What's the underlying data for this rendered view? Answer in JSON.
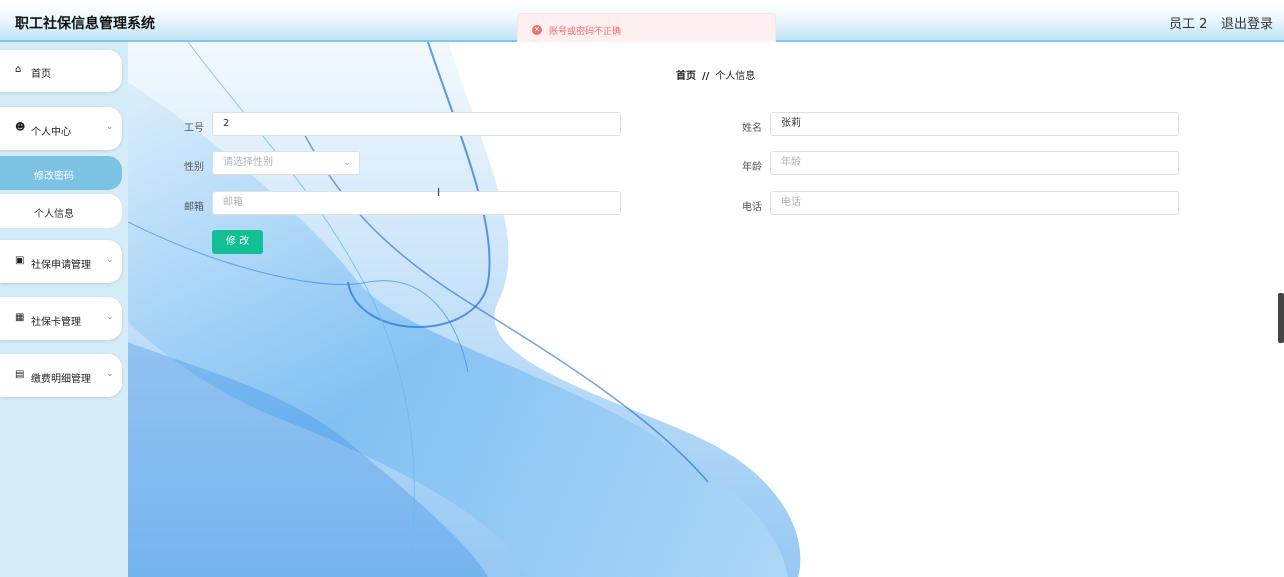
{
  "app": {
    "title": "职工社保信息管理系统"
  },
  "header": {
    "user": "员工 2",
    "logout": "退出登录"
  },
  "toast": {
    "message": "账号或密码不正确",
    "color": "#f56c6c"
  },
  "sidebar": {
    "items": [
      {
        "icon": "home-icon",
        "label": "首页"
      },
      {
        "icon": "user-icon",
        "label": "个人中心",
        "expanded": true,
        "children": [
          {
            "label": "修改密码",
            "active": true
          },
          {
            "label": "个人信息",
            "active": false
          }
        ]
      },
      {
        "icon": "monitor-icon",
        "label": "社保申请管理"
      },
      {
        "icon": "grid-icon",
        "label": "社保卡管理"
      },
      {
        "icon": "receipt-icon",
        "label": "缴费明细管理"
      }
    ]
  },
  "breadcrumb": {
    "home": "首页",
    "separator": "//",
    "current": "个人信息"
  },
  "form": {
    "employee_id": {
      "label": "工号",
      "value": "2"
    },
    "name": {
      "label": "姓名",
      "value": "张莉"
    },
    "gender": {
      "label": "性别",
      "placeholder": "请选择性别"
    },
    "age": {
      "label": "年龄",
      "placeholder": "年龄"
    },
    "email": {
      "label": "邮箱",
      "placeholder": "邮箱"
    },
    "phone": {
      "label": "电话",
      "placeholder": "电话"
    },
    "submit_label": "修 改"
  },
  "colors": {
    "accent": "#7cc3e3",
    "submit": "#13c095",
    "sidebar_bg": "#d4ecf7"
  }
}
